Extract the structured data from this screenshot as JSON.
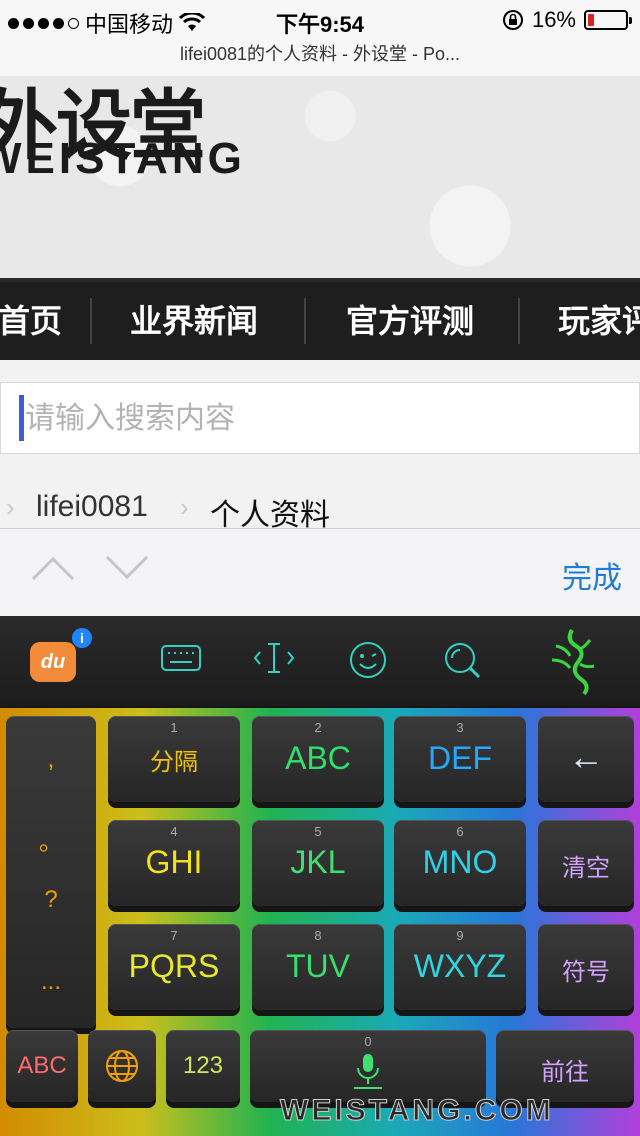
{
  "status_bar": {
    "carrier": "中国移动",
    "time": "下午9:54",
    "battery": "16%",
    "battery_level": 0.16,
    "signal_bars": 4
  },
  "browser": {
    "page_title": "lifei0081的个人资料 - 外设堂 - Po..."
  },
  "site": {
    "logo_cn": "外设堂",
    "logo_en": "WEISTANG"
  },
  "nav": {
    "items": [
      "首页",
      "业界新闻",
      "官方评测",
      "玩家评"
    ]
  },
  "search": {
    "placeholder": "请输入搜索内容",
    "value": ""
  },
  "breadcrumb": {
    "items": [
      "lifei0081",
      "个人资料"
    ]
  },
  "accessory": {
    "done_label": "完成"
  },
  "keyboard": {
    "brand_label": "du",
    "info_badge": "i",
    "punct_keys": [
      ",",
      "。",
      "?",
      "..."
    ],
    "keys": [
      {
        "num": "1",
        "label": "分隔",
        "color": "#f2c300"
      },
      {
        "num": "2",
        "label": "ABC",
        "color": "#2fe06a"
      },
      {
        "num": "3",
        "label": "DEF",
        "color": "#27a8ff"
      },
      {
        "num": "4",
        "label": "GHI",
        "color": "#f6e21c"
      },
      {
        "num": "5",
        "label": "JKL",
        "color": "#3fe070"
      },
      {
        "num": "6",
        "label": "MNO",
        "color": "#2fd0e8"
      },
      {
        "num": "7",
        "label": "PQRS",
        "color": "#e8e830"
      },
      {
        "num": "8",
        "label": "TUV",
        "color": "#36e06a"
      },
      {
        "num": "9",
        "label": "WXYZ",
        "color": "#2fd6e0"
      }
    ],
    "side_keys": {
      "backspace": "←",
      "clear": "清空",
      "symbols": "符号"
    },
    "bottom_keys": {
      "abc": "ABC",
      "num": "123",
      "space_num": "0",
      "go": "前往"
    }
  },
  "watermark": "WEISTANG.COM"
}
